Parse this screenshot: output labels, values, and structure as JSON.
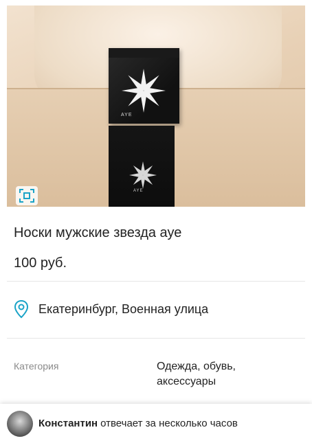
{
  "listing": {
    "title": "Носки мужские звезда ауе",
    "price": "100 руб.",
    "location": "Екатеринбург, Военная улица",
    "pack_text": "AYE",
    "sock_text": "AYE",
    "icons": {
      "zoom": "fullscreen-icon",
      "location": "location-pin-icon"
    },
    "accent_color": "#1aa3c7"
  },
  "details": {
    "category_label": "Категория",
    "category_value": "Одежда, обувь, аксессуары"
  },
  "seller": {
    "name": "Константин",
    "reply_note": "отвечает за несколько часов"
  }
}
